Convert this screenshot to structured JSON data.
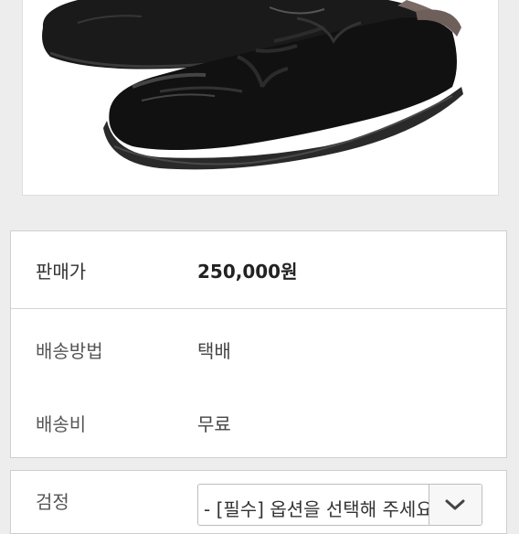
{
  "product_image": {
    "alt": "black leather shoes"
  },
  "info": {
    "price_label": "판매가",
    "price_value": "250,000원",
    "shipping_method_label": "배송방법",
    "shipping_method_value": "택배",
    "shipping_fee_label": "배송비",
    "shipping_fee_value": "무료"
  },
  "option": {
    "label": "검정",
    "select_value": "- [필수] 옵션을 선택해 주세요 -",
    "dropdown_icon": "chevron-down-icon"
  }
}
